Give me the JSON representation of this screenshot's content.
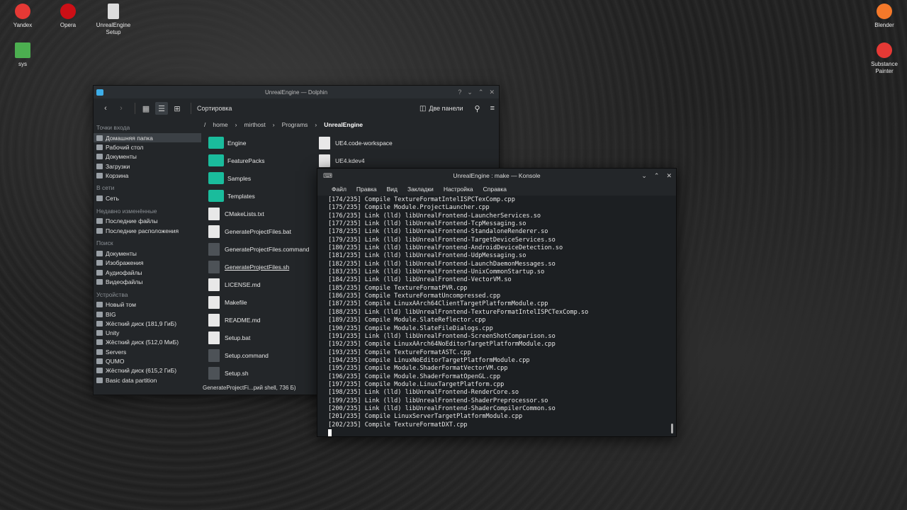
{
  "desktop": {
    "left_icons": [
      {
        "label": "Yandex",
        "icon": "yandex-icon",
        "color": "#e53935"
      },
      {
        "label": "Opera",
        "icon": "opera-icon",
        "color": "#cc0f16"
      },
      {
        "label": "UnrealEngine Setup",
        "icon": "document-icon",
        "color": "#dddddd"
      },
      {
        "label": "sys",
        "icon": "image-icon",
        "color": "#4caf50"
      }
    ],
    "right_icons": [
      {
        "label": "Blender",
        "icon": "blender-icon",
        "color": "#f5792a"
      },
      {
        "label": "Substance Painter",
        "icon": "substance-painter-icon",
        "color": "#e53935"
      }
    ]
  },
  "dolphin": {
    "title": "UnrealEngine — Dolphin",
    "toolbar": {
      "sort_label": "Сортировка",
      "split_label": "Две панели"
    },
    "sidebar": {
      "sections": [
        {
          "header": "Точки входа",
          "items": [
            "Домашняя папка",
            "Рабочий стол",
            "Документы",
            "Загрузки",
            "Корзина"
          ]
        },
        {
          "header": "В сети",
          "items": [
            "Сеть"
          ]
        },
        {
          "header": "Недавно изменённые",
          "items": [
            "Последние файлы",
            "Последние расположения"
          ]
        },
        {
          "header": "Поиск",
          "items": [
            "Документы",
            "Изображения",
            "Аудиофайлы",
            "Видеофайлы"
          ]
        },
        {
          "header": "Устройства",
          "items": [
            "Новый том",
            "BIG",
            "Жёсткий диск (181,9 ГиБ)",
            "Unity",
            "Жёсткий диск (512,0 МиБ)",
            "Servers",
            "QUMO",
            "Жёсткий диск (615,2 ГиБ)",
            "Basic data partition"
          ]
        }
      ],
      "selected": "Домашняя папка"
    },
    "breadcrumb": {
      "root": "/",
      "parts": [
        "home",
        "mirthost",
        "Programs"
      ],
      "current": "UnrealEngine"
    },
    "files_col1": [
      {
        "name": "Engine",
        "type": "folder"
      },
      {
        "name": "FeaturePacks",
        "type": "folder"
      },
      {
        "name": "Samples",
        "type": "folder"
      },
      {
        "name": "Templates",
        "type": "folder"
      },
      {
        "name": "CMakeLists.txt",
        "type": "doc"
      },
      {
        "name": "GenerateProjectFiles.bat",
        "type": "doc"
      },
      {
        "name": "GenerateProjectFiles.command",
        "type": "script"
      },
      {
        "name": "GenerateProjectFiles.sh",
        "type": "script"
      },
      {
        "name": "LICENSE.md",
        "type": "doc"
      },
      {
        "name": "Makefile",
        "type": "doc"
      },
      {
        "name": "README.md",
        "type": "doc"
      },
      {
        "name": "Setup.bat",
        "type": "doc"
      },
      {
        "name": "Setup.command",
        "type": "script"
      },
      {
        "name": "Setup.sh",
        "type": "script"
      }
    ],
    "files_col2": [
      {
        "name": "UE4.code-workspace",
        "type": "doc"
      },
      {
        "name": "UE4.kdev4",
        "type": "doc"
      }
    ],
    "hovered_file": "GenerateProjectFiles.sh",
    "status": "GenerateProjectFi...рий shell, 736 Б)"
  },
  "konsole": {
    "title": "UnrealEngine : make — Konsole",
    "menu": [
      "Файл",
      "Правка",
      "Вид",
      "Закладки",
      "Настройка",
      "Справка"
    ],
    "lines": [
      "[174/235] Compile TextureFormatIntelISPCTexComp.cpp",
      "[175/235] Compile Module.ProjectLauncher.cpp",
      "[176/235] Link (lld) libUnrealFrontend-LauncherServices.so",
      "[177/235] Link (lld) libUnrealFrontend-TcpMessaging.so",
      "[178/235] Link (lld) libUnrealFrontend-StandaloneRenderer.so",
      "[179/235] Link (lld) libUnrealFrontend-TargetDeviceServices.so",
      "[180/235] Link (lld) libUnrealFrontend-AndroidDeviceDetection.so",
      "[181/235] Link (lld) libUnrealFrontend-UdpMessaging.so",
      "[182/235] Link (lld) libUnrealFrontend-LaunchDaemonMessages.so",
      "[183/235] Link (lld) libUnrealFrontend-UnixCommonStartup.so",
      "[184/235] Link (lld) libUnrealFrontend-VectorVM.so",
      "[185/235] Compile TextureFormatPVR.cpp",
      "[186/235] Compile TextureFormatUncompressed.cpp",
      "[187/235] Compile LinuxAArch64ClientTargetPlatformModule.cpp",
      "[188/235] Link (lld) libUnrealFrontend-TextureFormatIntelISPCTexComp.so",
      "[189/235] Compile Module.SlateReflector.cpp",
      "[190/235] Compile Module.SlateFileDialogs.cpp",
      "[191/235] Link (lld) libUnrealFrontend-ScreenShotComparison.so",
      "[192/235] Compile LinuxAArch64NoEditorTargetPlatformModule.cpp",
      "[193/235] Compile TextureFormatASTC.cpp",
      "[194/235] Compile LinuxNoEditorTargetPlatformModule.cpp",
      "[195/235] Compile Module.ShaderFormatVectorVM.cpp",
      "[196/235] Compile Module.ShaderFormatOpenGL.cpp",
      "[197/235] Compile Module.LinuxTargetPlatform.cpp",
      "[198/235] Link (lld) libUnrealFrontend-RenderCore.so",
      "[199/235] Link (lld) libUnrealFrontend-ShaderPreprocessor.so",
      "[200/235] Link (lld) libUnrealFrontend-ShaderCompilerCommon.so",
      "[201/235] Compile LinuxServerTargetPlatformModule.cpp",
      "[202/235] Compile TextureFormatDXT.cpp"
    ]
  }
}
